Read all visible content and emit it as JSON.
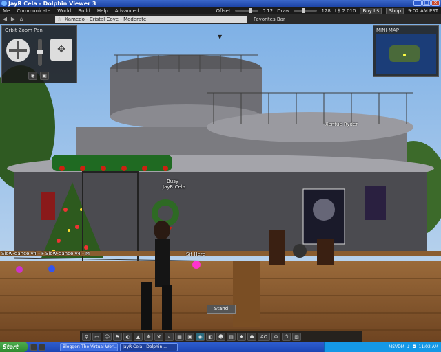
{
  "window": {
    "title": "JayR Cela - Dolphin Viewer 3"
  },
  "menubar": {
    "items": [
      "Me",
      "Communicate",
      "World",
      "Build",
      "Help",
      "Advanced"
    ],
    "offset_label": "Offset",
    "offset_value": "0.12",
    "draw_label": "Draw",
    "draw_value": "128",
    "balance": "L$ 2.010",
    "buy_label": "Buy L$",
    "shop_label": "Shop",
    "time": "9:02 AM PST"
  },
  "navbar": {
    "location": "Xamedo - Cristal Cove - Moderate",
    "favorites_label": "Favorites Bar"
  },
  "panels": {
    "orbit_title": "Orbit Zoom Pan",
    "minimap_title": "MINI-MAP"
  },
  "scene": {
    "avatar_status": "Busy",
    "avatar_name": "JayR Cela",
    "nametag_other": "Xentue Ryder",
    "label_dance1": "Slow-dance v4 - F",
    "label_dance2": "Slow-dance v4 - M",
    "label_sit": "Sit Here",
    "stand_button": "Stand"
  },
  "bottom_toolbar": {
    "icons": [
      "pin-icon",
      "chat-icon",
      "people-icon",
      "location-icon",
      "speak-icon",
      "camera-icon",
      "move-icon",
      "build-icon",
      "search-icon",
      "map-icon",
      "minimap-icon",
      "view-icon",
      "snapshot-icon",
      "gesture-icon",
      "inventory-icon",
      "appearance-icon",
      "profile-icon",
      "settings-icon",
      "power-icon",
      "photo-icon"
    ],
    "ao_label": "AO"
  },
  "taskbar": {
    "start_label": "Start",
    "tasks": [
      "Blogger: The Virtual Worl...",
      "JayR Cela - Dolphin ..."
    ],
    "tray_label": "MSVDM",
    "clock": "11:02 AM"
  },
  "colors": {
    "sky": "#7fb1e6",
    "floor": "#8a5a2e",
    "accent": "#1d44a6"
  }
}
